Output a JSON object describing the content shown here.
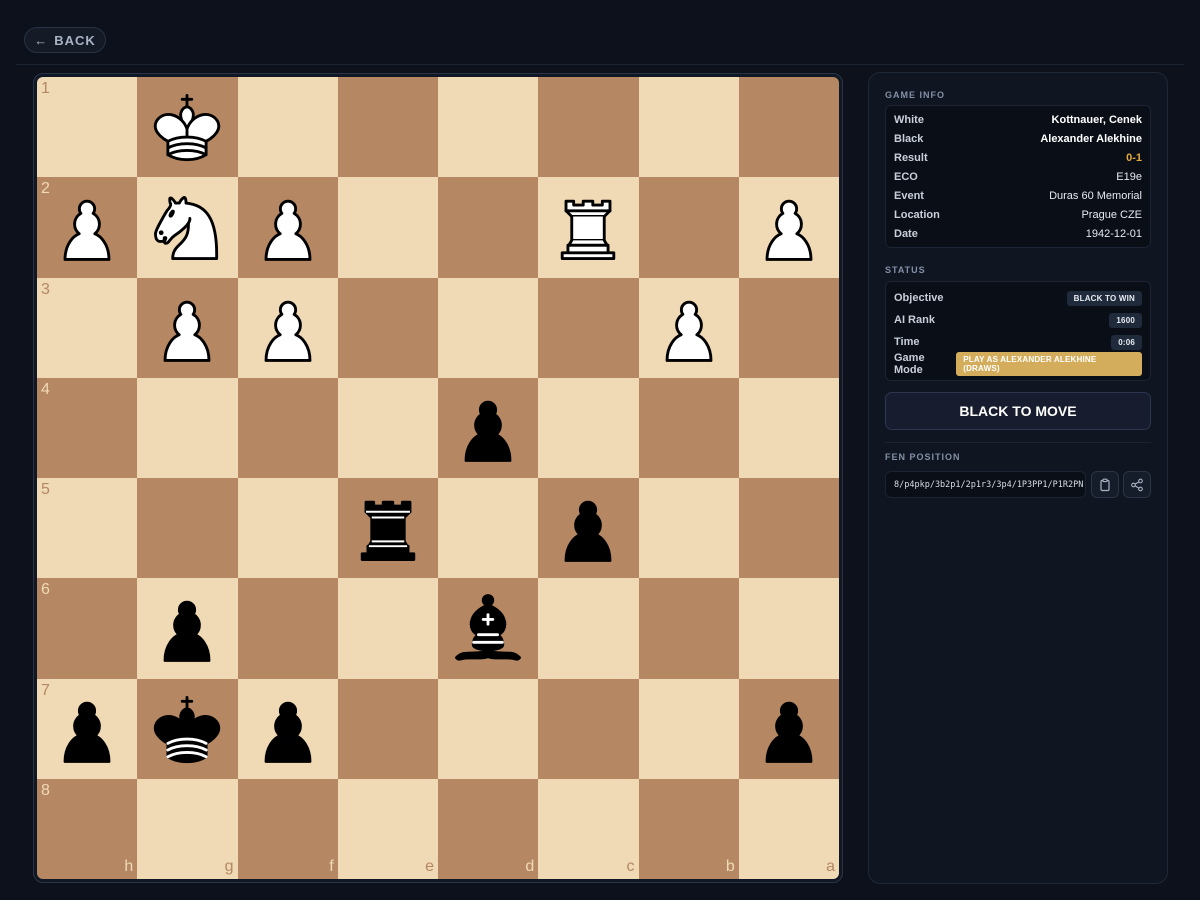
{
  "nav": {
    "back_label": "BACK"
  },
  "board": {
    "rank_labels": [
      "1",
      "2",
      "3",
      "4",
      "5",
      "6",
      "7",
      "8"
    ],
    "file_labels": [
      "h",
      "g",
      "f",
      "e",
      "d",
      "c",
      "b",
      "a"
    ],
    "rows": [
      [
        "",
        "K",
        "",
        "",
        "",
        "",
        "",
        ""
      ],
      [
        "P",
        "N",
        "P",
        "",
        "",
        "R",
        "",
        "P"
      ],
      [
        "",
        "P",
        "P",
        "",
        "",
        "",
        "P",
        ""
      ],
      [
        "",
        "",
        "",
        "",
        "p",
        "",
        "",
        ""
      ],
      [
        "",
        "",
        "",
        "r",
        "",
        "p",
        "",
        ""
      ],
      [
        "",
        "p",
        "",
        "",
        "b",
        "",
        "",
        ""
      ],
      [
        "p",
        "k",
        "p",
        "",
        "",
        "",
        "",
        "p"
      ],
      [
        "",
        "",
        "",
        "",
        "",
        "",
        "",
        ""
      ]
    ],
    "colors": {
      "light": "#f0d9b5",
      "dark": "#b58863"
    }
  },
  "game_info": {
    "section_title": "GAME INFO",
    "white_label": "White",
    "white": "Kottnauer, Cenek",
    "black_label": "Black",
    "black": "Alexander Alekhine",
    "result_label": "Result",
    "result": "0-1",
    "eco_label": "ECO",
    "eco": "E19e",
    "event_label": "Event",
    "event": "Duras 60 Memorial",
    "location_label": "Location",
    "location": "Prague CZE",
    "date_label": "Date",
    "date": "1942-12-01"
  },
  "status": {
    "section_title": "STATUS",
    "objective_label": "Objective",
    "objective": "BLACK TO WIN",
    "ai_rank_label": "AI Rank",
    "ai_rank": "1600",
    "time_label": "Time",
    "time": "0:06",
    "game_mode_label": "Game Mode",
    "game_mode": "PLAY AS ALEXANDER ALEKHINE (DRAWS)"
  },
  "turn": {
    "label": "BLACK TO MOVE"
  },
  "fen": {
    "section_title": "FEN POSITION",
    "value": "8/p4pkp/3b2p1/2p1r3/3p4/1P3PP1/P1R2PN"
  },
  "icons": {
    "back": "arrow-left-icon",
    "copy": "clipboard-icon",
    "share": "share-icon"
  },
  "accent_colors": {
    "result": "#e3a93a",
    "game_mode_pill": "#d4ad5c"
  }
}
